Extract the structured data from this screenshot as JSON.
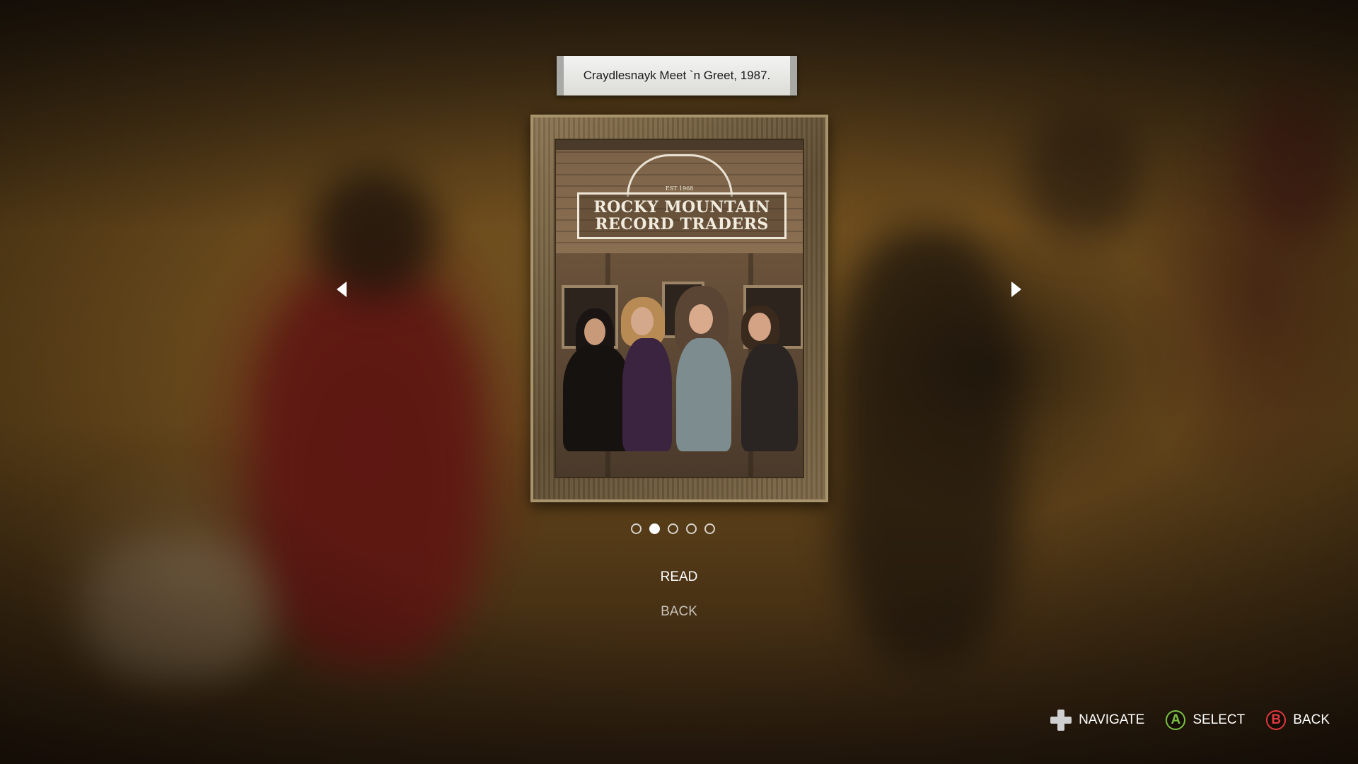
{
  "caption": {
    "text": "Craydlesnayk Meet `n Greet, 1987."
  },
  "photo": {
    "sign_est": "EST 1968",
    "sign_line1": "ROCKY MOUNTAIN",
    "sign_line2": "RECORD TRADERS"
  },
  "pagination": {
    "total": 5,
    "current_index": 1
  },
  "menu": {
    "read_label": "READ",
    "back_label": "BACK"
  },
  "hints": {
    "navigate_label": "NAVIGATE",
    "select_label": "SELECT",
    "select_button": "A",
    "back_label": "BACK",
    "back_button": "B"
  },
  "colors": {
    "accent_pink": "#e81f77",
    "a_button_green": "#7bc043",
    "b_button_red": "#e0383e"
  }
}
